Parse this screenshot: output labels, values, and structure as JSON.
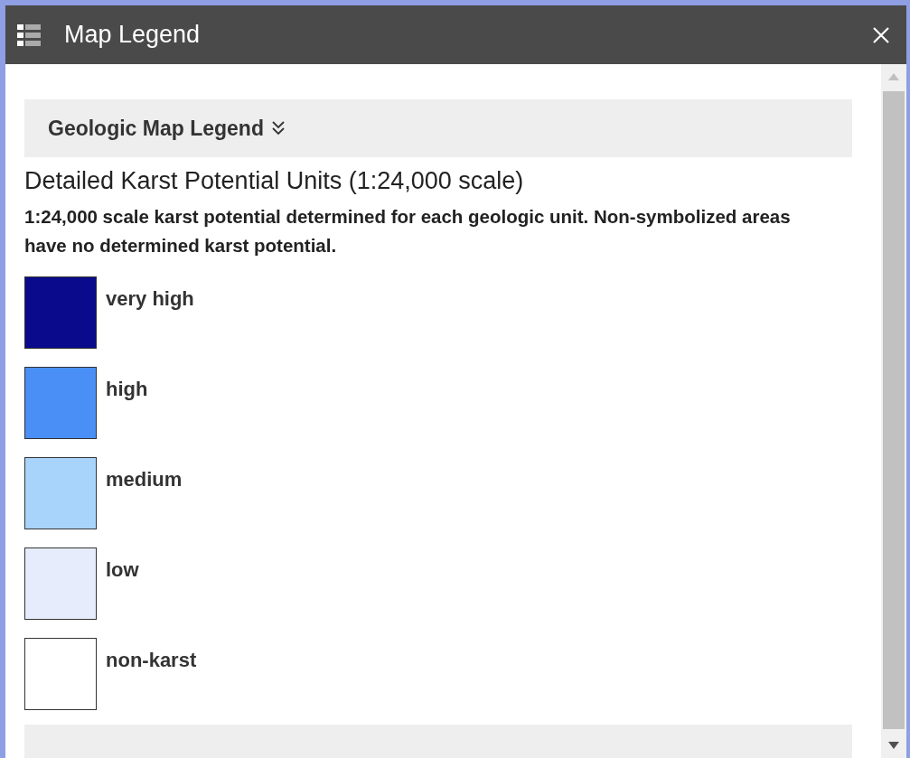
{
  "window": {
    "title": "Map Legend"
  },
  "sections": [
    {
      "label": "Geologic Map Legend",
      "expanded": true
    }
  ],
  "layer": {
    "title": "Detailed Karst Potential Units (1:24,000 scale)",
    "description": "1:24,000 scale karst potential determined for each geologic unit. Non-symbolized areas have no determined karst potential.",
    "items": [
      {
        "label": "very high",
        "color": "#0a0a8c"
      },
      {
        "label": "high",
        "color": "#4a8ff5"
      },
      {
        "label": "medium",
        "color": "#a8d4fc"
      },
      {
        "label": "low",
        "color": "#e6ecfc"
      },
      {
        "label": "non-karst",
        "color": "#ffffff"
      }
    ]
  }
}
